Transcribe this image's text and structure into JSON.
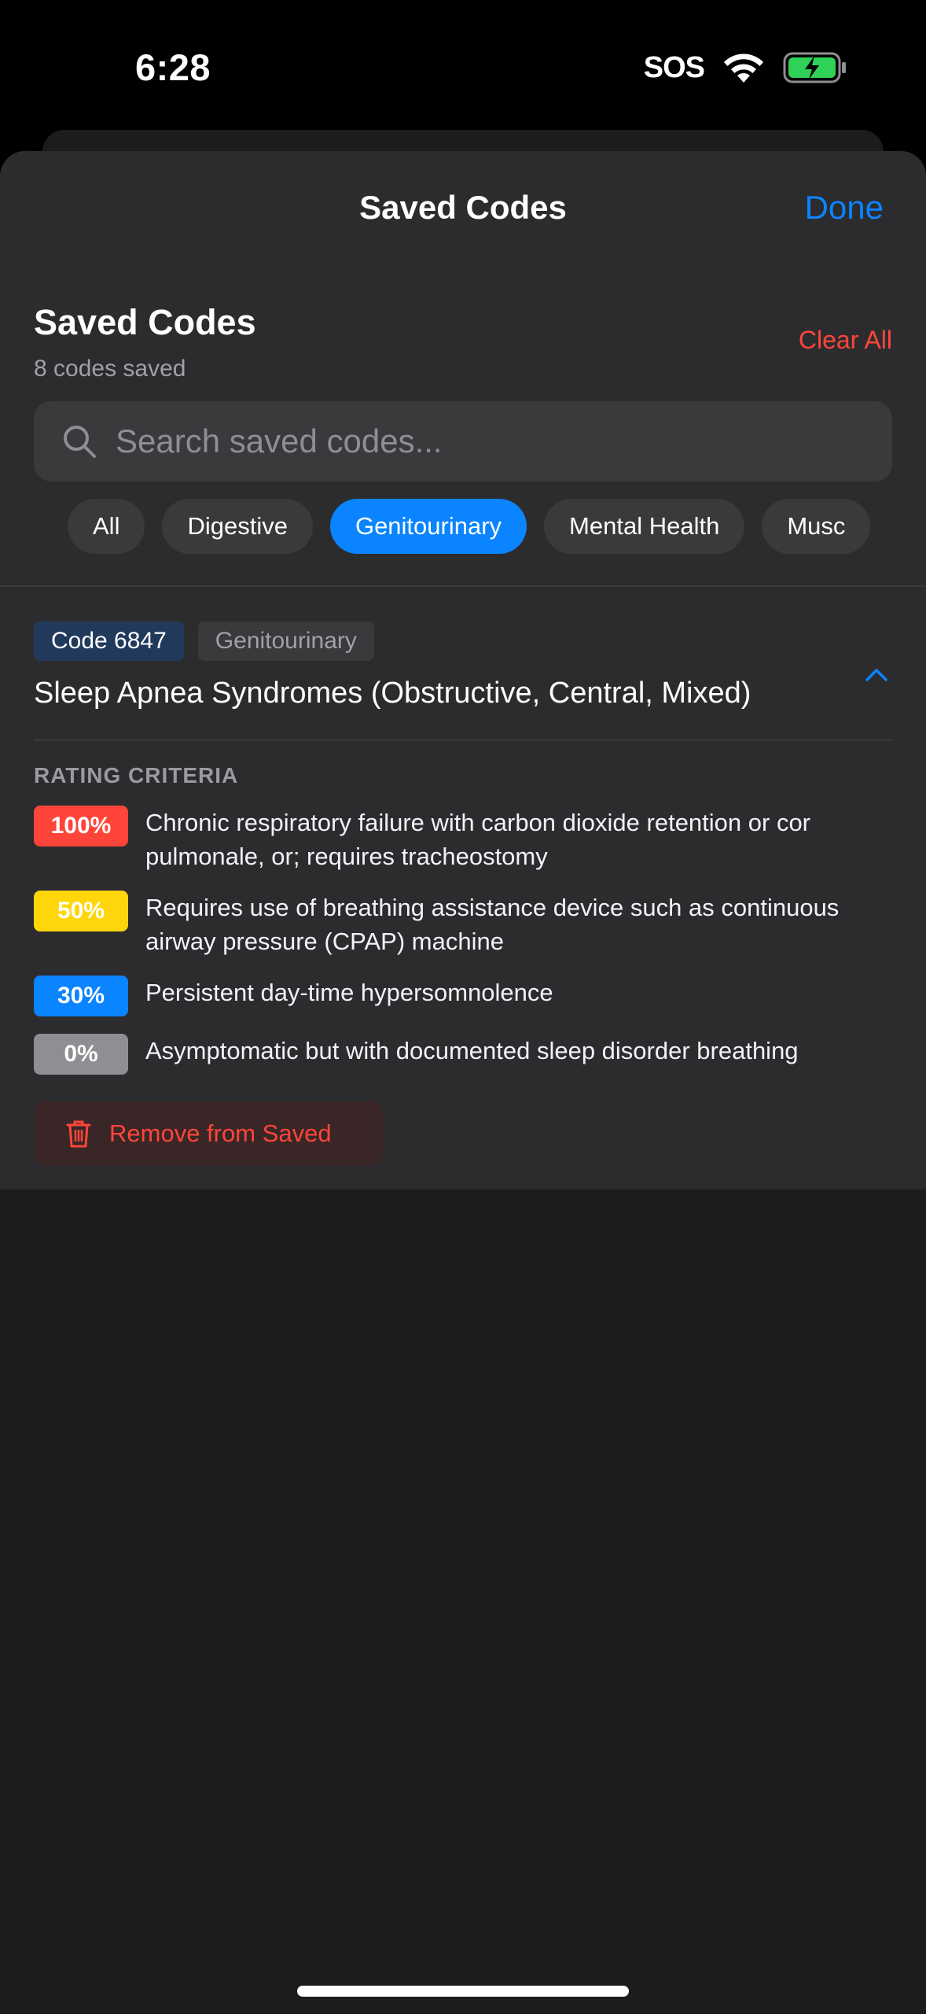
{
  "status": {
    "time": "6:28",
    "sos": "SOS"
  },
  "nav": {
    "title": "Saved Codes",
    "done": "Done"
  },
  "list": {
    "title": "Saved Codes",
    "subtitle": "8 codes saved",
    "clear_all": "Clear All"
  },
  "search": {
    "placeholder": "Search saved codes..."
  },
  "chips": [
    "All",
    "Digestive",
    "Genitourinary",
    "Mental Health",
    "Musc"
  ],
  "active_chip": "Genitourinary",
  "card": {
    "code": "Code 6847",
    "category": "Genitourinary",
    "title": "Sleep Apnea Syndromes (Obstructive, Central, Mixed)",
    "criteria_label": "RATING CRITERIA",
    "criteria": [
      {
        "badge": "100%",
        "color": "#ff453a",
        "text": "Chronic respiratory failure with carbon dioxide retention or cor pulmonale, or; requires tracheostomy"
      },
      {
        "badge": "50%",
        "color": "#ffd60a",
        "text": "Requires use of breathing assistance device such as continuous airway pressure (CPAP) machine"
      },
      {
        "badge": "30%",
        "color": "#0a84ff",
        "text": "Persistent day-time hypersomnolence"
      },
      {
        "badge": "0%",
        "color": "#8e8e93",
        "text": "Asymptomatic but with documented sleep disorder breathing"
      }
    ],
    "remove_label": "Remove from Saved"
  },
  "colors": {
    "accent": "#0a84ff",
    "destructive": "#ff453a",
    "sheet": "#2c2c2e",
    "background": "#1c1c1e"
  }
}
